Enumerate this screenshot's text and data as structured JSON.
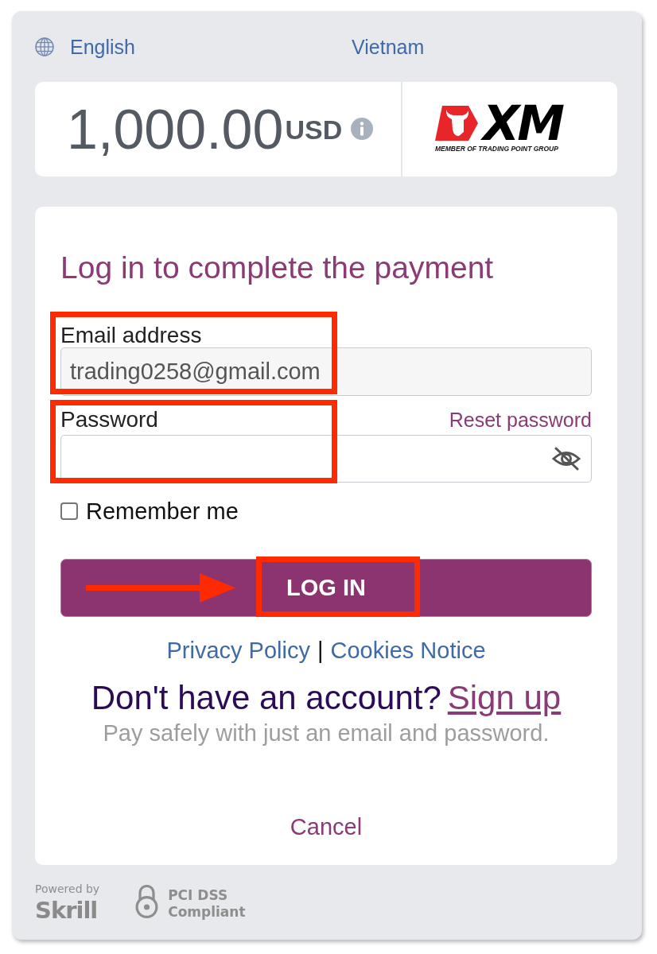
{
  "header": {
    "language": "English",
    "country": "Vietnam"
  },
  "amount": {
    "value": "1,000.00",
    "currency": "USD"
  },
  "merchant_logo": {
    "wordmark": "XM",
    "tagline": "MEMBER OF TRADING POINT GROUP"
  },
  "login": {
    "title": "Log in to complete the payment",
    "fields": [
      {
        "kind": "email",
        "label": "Email address",
        "value": "trading0258@gmail.com",
        "highlighted": true
      },
      {
        "kind": "password",
        "label": "Password",
        "link": "Reset password",
        "highlighted": true
      }
    ],
    "remember_me": {
      "label": "Remember me",
      "checked": false
    },
    "submit": {
      "label": "LOG IN",
      "highlighted": true,
      "arrow": true
    },
    "legal_links": [
      {
        "label": "Privacy Policy"
      },
      {
        "label": "Cookies Notice"
      }
    ],
    "legal_separator": "|",
    "signup": {
      "question": "Don't have an account?",
      "link": "Sign up"
    },
    "note": "Pay safely with just an email and password.",
    "cancel": "Cancel"
  },
  "footer": {
    "powered_by": "Powered by",
    "brand": "Skrill",
    "badge_lines": [
      "PCI DSS",
      "Compliant"
    ]
  }
}
